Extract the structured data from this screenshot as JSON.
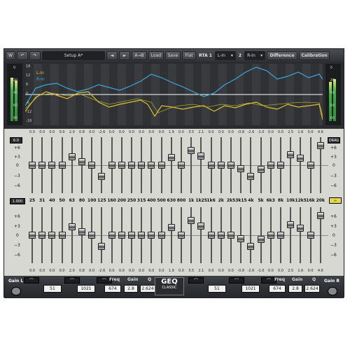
{
  "toolbar": {
    "setup": "Setup A*",
    "ab": "A→B",
    "load": "Load",
    "save": "Save",
    "flat": "Flat",
    "rta_label": "RTA 1",
    "rta_source": "L-In",
    "second_num": "2",
    "second_source": "R-In",
    "difference": "Difference",
    "calibration": "Calibration"
  },
  "analyzer": {
    "legend_left": "L-In",
    "legend_right": "R-In",
    "left_scale": [
      "0",
      "20",
      "40",
      "60",
      "80"
    ],
    "db_scale": [
      "18",
      "12",
      "6",
      "0",
      "-6",
      "-12",
      "-18"
    ],
    "right_scale": [
      "0",
      "20",
      "40",
      "60",
      "80"
    ]
  },
  "eq": {
    "frequencies": [
      "25",
      "31",
      "40",
      "50",
      "63",
      "80",
      "100",
      "125",
      "160",
      "200",
      "250",
      "315",
      "400",
      "500",
      "630",
      "800",
      "1k",
      "1k25",
      "1k6",
      "2k",
      "2k5",
      "3k15",
      "4k",
      "5k",
      "6k3",
      "8k",
      "10k",
      "12k5",
      "16k",
      "20k"
    ],
    "gains": [
      "0.0",
      "0.0",
      "0.0",
      "0.0",
      "2.0",
      "0.8",
      "0.0",
      "-2.6",
      "0.0",
      "0.0",
      "0.0",
      "0.0",
      "0.0",
      "0.0",
      "1.9",
      "0.0",
      "3.5",
      "2.1",
      "0.0",
      "0.0",
      "0.0",
      "-0.8",
      "-2.6",
      "-1.0",
      "0.0",
      "0.0",
      "2.5",
      "1.6",
      "0.0",
      "4.6"
    ],
    "scale": [
      "+6",
      "+3",
      "0",
      "−3",
      "−6"
    ],
    "top_left_btn": "6.0",
    "top_right_btn": "DRAG",
    "mid_left_btn": "1.000"
  },
  "bottom": {
    "gain_l": "Gain L",
    "gain_r": "Gain R",
    "freq_label": "Freq",
    "gain_label": "Gain",
    "q_label": "Q",
    "left_low_val": "51",
    "left_high_val": "1021",
    "left_freq": "674",
    "left_gain": "2.8",
    "left_q": "2.624",
    "right_low_val": "51",
    "right_high_val": "1021",
    "right_freq": "674",
    "right_gain": "2.8",
    "right_q": "2.624",
    "logo_main": "GEQ",
    "logo_sub": "CLASSIC"
  },
  "colors": {
    "l_in": "#e0c030",
    "r_in": "#3aa8e0",
    "panel": "#d8d8d3"
  }
}
